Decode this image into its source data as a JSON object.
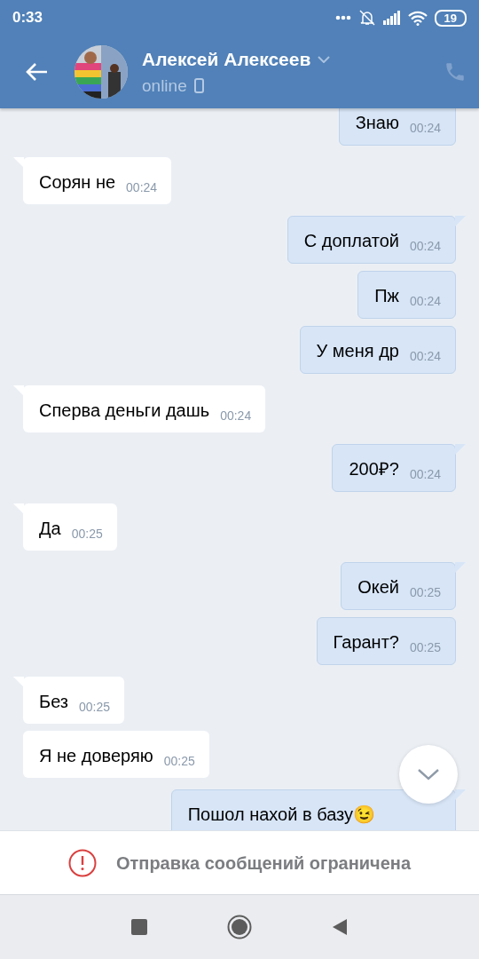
{
  "status_bar": {
    "time": "0:33",
    "battery": "19"
  },
  "header": {
    "name": "Алексей Алексеев",
    "status": "online"
  },
  "messages": [
    {
      "kind": "outgoing",
      "text": "Знаю",
      "time": "00:24"
    },
    {
      "kind": "incoming",
      "text": "Сорян не",
      "time": "00:24"
    },
    {
      "kind": "outgoing",
      "text": "С доплатой",
      "time": "00:24"
    },
    {
      "kind": "outgoing",
      "text": "Пж",
      "time": "00:24"
    },
    {
      "kind": "outgoing",
      "text": "У меня др",
      "time": "00:24"
    },
    {
      "kind": "incoming",
      "text": "Сперва деньги дашь",
      "time": "00:24"
    },
    {
      "kind": "outgoing",
      "text": "200₽?",
      "time": "00:24"
    },
    {
      "kind": "incoming",
      "text": "Да",
      "time": "00:25"
    },
    {
      "kind": "outgoing",
      "text": "Окей",
      "time": "00:25"
    },
    {
      "kind": "outgoing",
      "text": "Гарант?",
      "time": "00:25"
    },
    {
      "kind": "incoming",
      "text": "Без",
      "time": "00:25"
    },
    {
      "kind": "incoming",
      "text": "Я не доверяю",
      "time": "00:25"
    },
    {
      "kind": "outgoing",
      "text": "Пошол нахой в базу",
      "emoji": "😉"
    }
  ],
  "notice": "Отправка сообщений ограничена"
}
